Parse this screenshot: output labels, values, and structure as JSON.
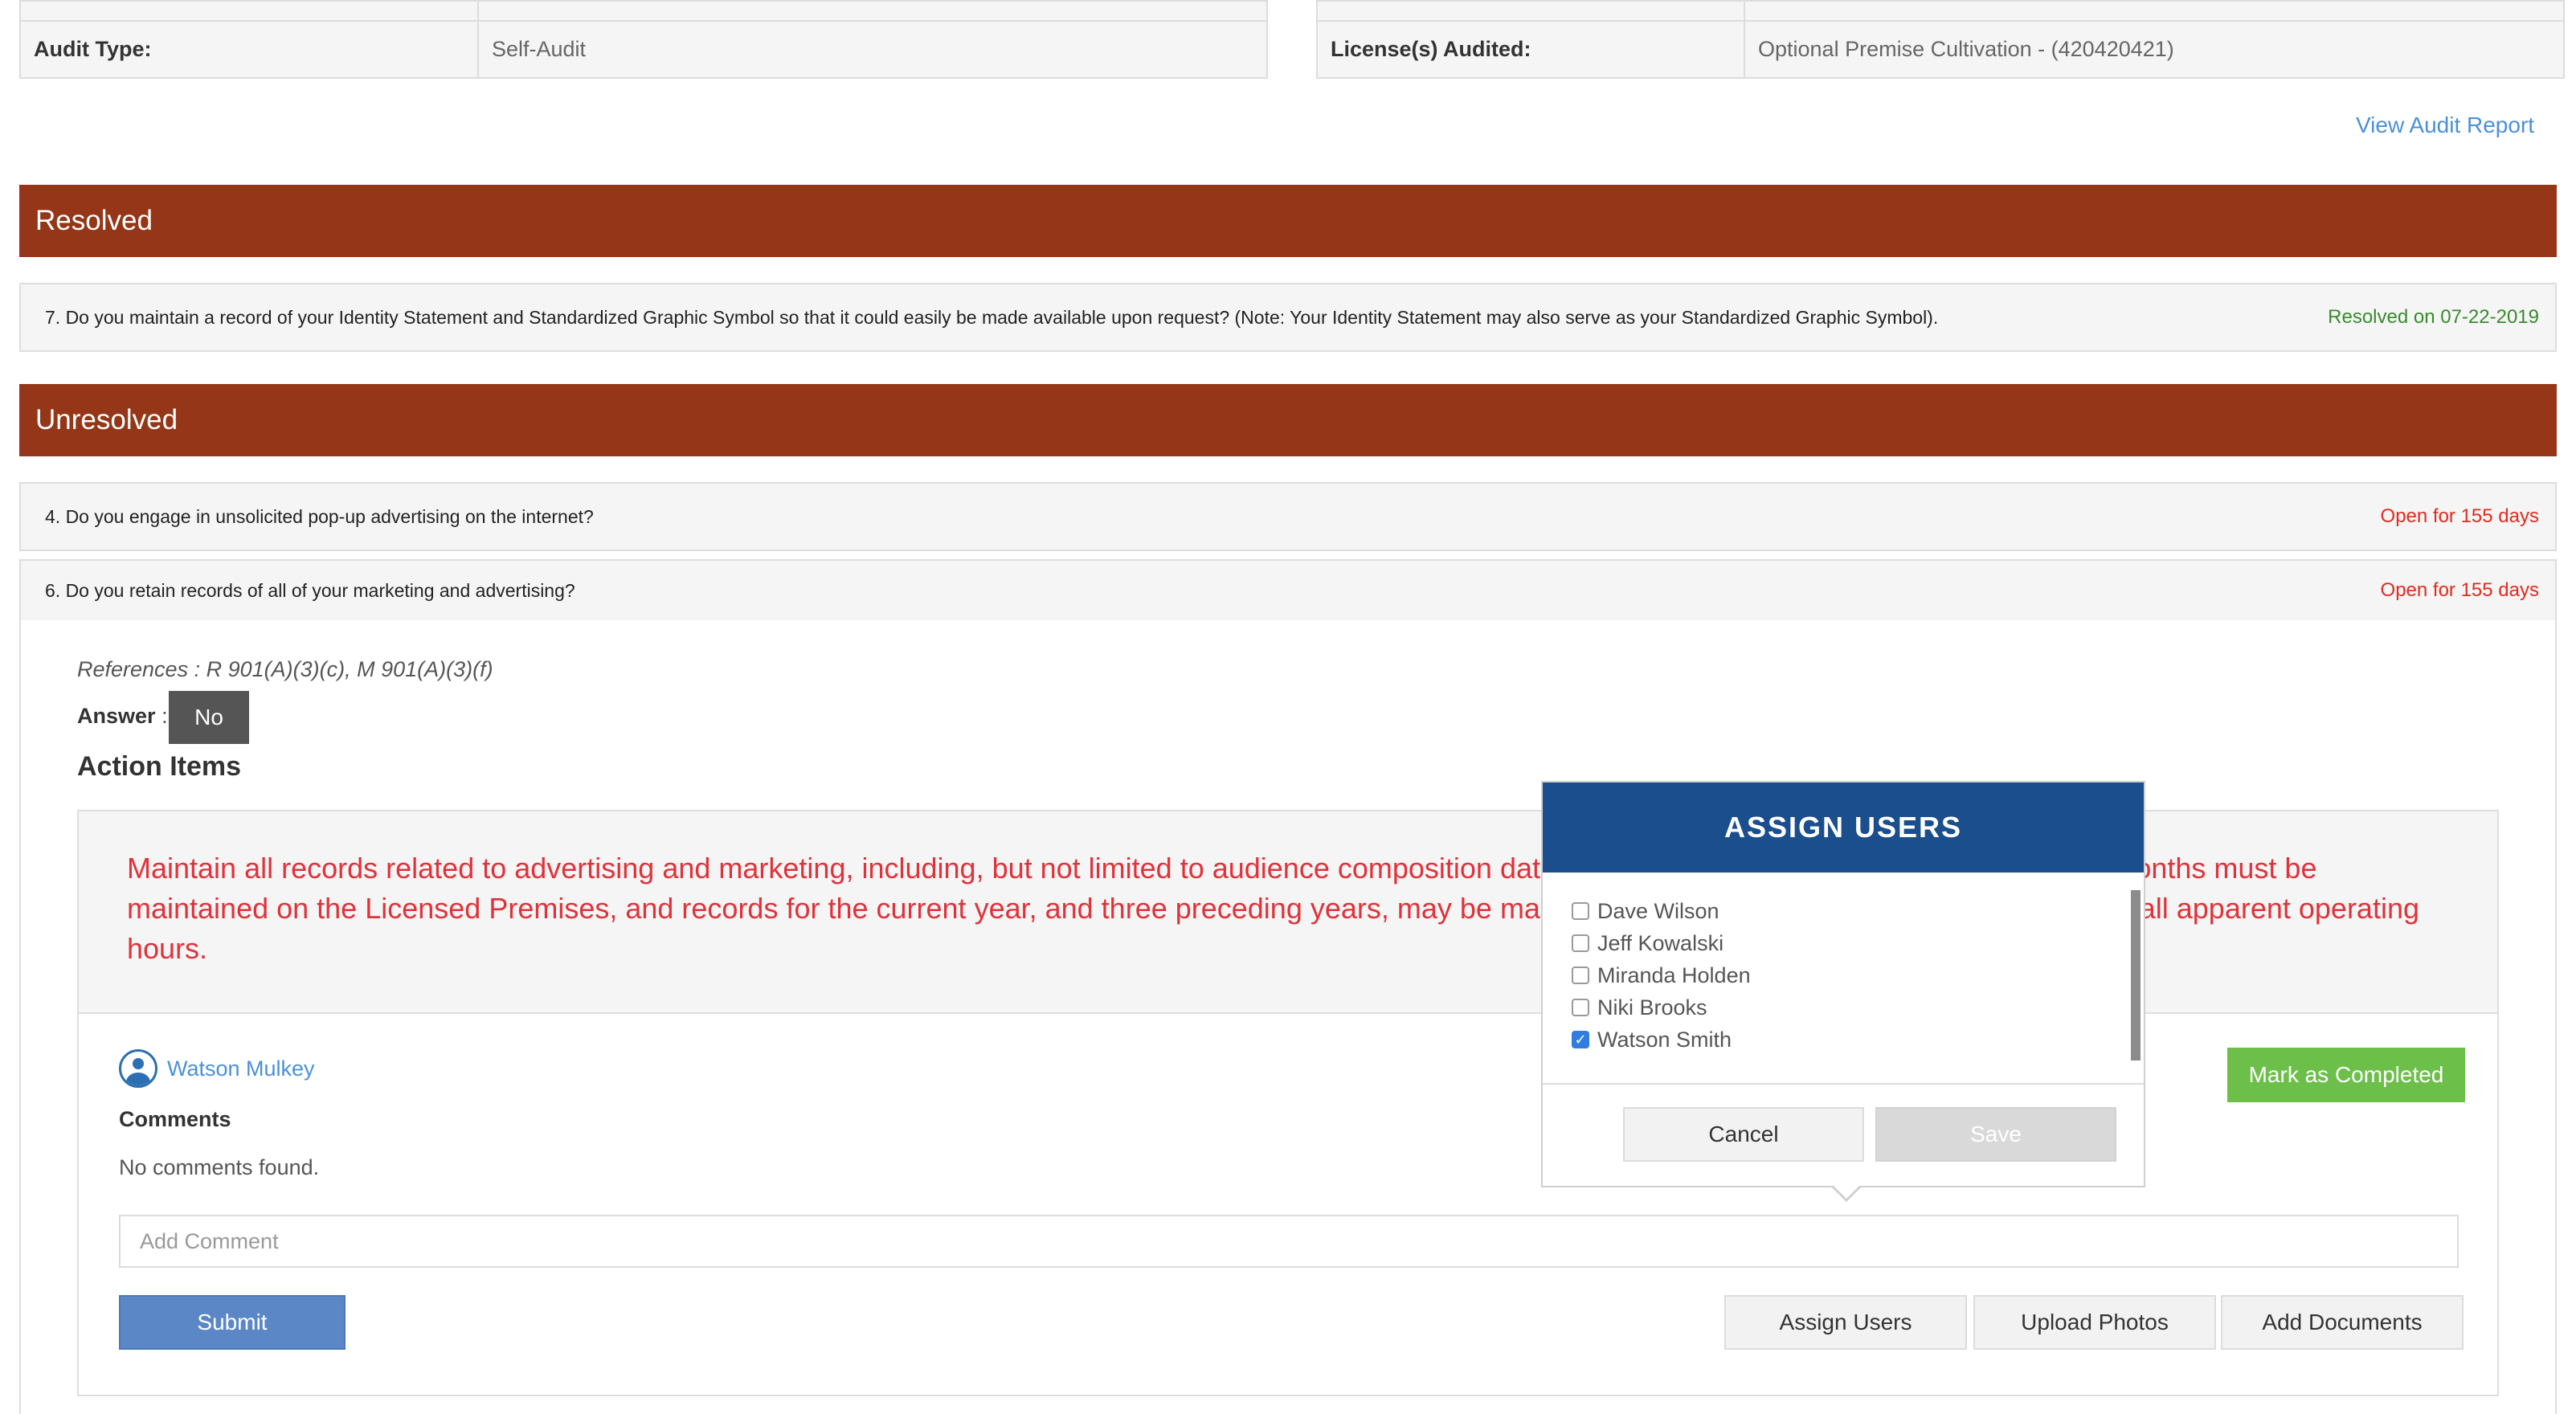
{
  "audit_info": {
    "left": {
      "label": "Audit Type:",
      "value": "Self-Audit"
    },
    "right": {
      "label": "License(s) Audited:",
      "value": "Optional Premise Cultivation - (420420421)"
    },
    "view_report": "View Audit Report"
  },
  "resolved": {
    "title": "Resolved",
    "items": [
      {
        "question": "7. Do you maintain a record of your Identity Statement and Standardized Graphic Symbol so that it could easily be made available upon request? (Note: Your Identity Statement may also serve as your Standardized Graphic Symbol).",
        "status": "Resolved on 07-22-2019"
      }
    ]
  },
  "unresolved": {
    "title": "Unresolved",
    "items": [
      {
        "question": "4. Do you engage in unsolicited pop-up advertising on the internet?",
        "status": "Open for 155 days"
      },
      {
        "question": "6. Do you retain records of all of your marketing and advertising?",
        "status": "Open for 155 days"
      }
    ]
  },
  "detail": {
    "references": "References : R 901(A)(3)(c), M 901(A)(3)(f)",
    "answer_label": "Answer",
    "answer_colon": ":",
    "answer_value": "No",
    "action_items_title": "Action Items",
    "action_text": "Maintain all records related to advertising and marketing, including, but not limited to audience composition data. Records for the current and preceding six months must be maintained on the Licensed Premises, and records for the current year, and three preceding years, may be maintained off-site at a location accessible during all apparent operating hours.",
    "assigned_user": "Watson Mulkey",
    "comments_label": "Comments",
    "no_comments": "No comments found.",
    "comment_placeholder": "Add Comment",
    "submit": "Submit",
    "assign_users": "Assign Users",
    "upload_photos": "Upload Photos",
    "add_documents": "Add Documents",
    "mark_completed": "Mark as Completed"
  },
  "modal": {
    "title": "ASSIGN USERS",
    "users": [
      {
        "name": "Dave Wilson",
        "checked": false
      },
      {
        "name": "Jeff Kowalski",
        "checked": false
      },
      {
        "name": "Miranda Holden",
        "checked": false
      },
      {
        "name": "Niki Brooks",
        "checked": false
      },
      {
        "name": "Watson Smith",
        "checked": true
      }
    ],
    "cancel": "Cancel",
    "save": "Save"
  },
  "colors": {
    "banner": "#943617",
    "modal_header": "#1b4e8c",
    "submit": "#5b87c7",
    "mark_completed": "#6cc04a",
    "resolved_status": "#3a8a2e",
    "open_status": "#e02b1f",
    "action_text": "#e0323a"
  },
  "icons": {
    "user": "user-circle-icon",
    "check": "checkmark-icon"
  }
}
